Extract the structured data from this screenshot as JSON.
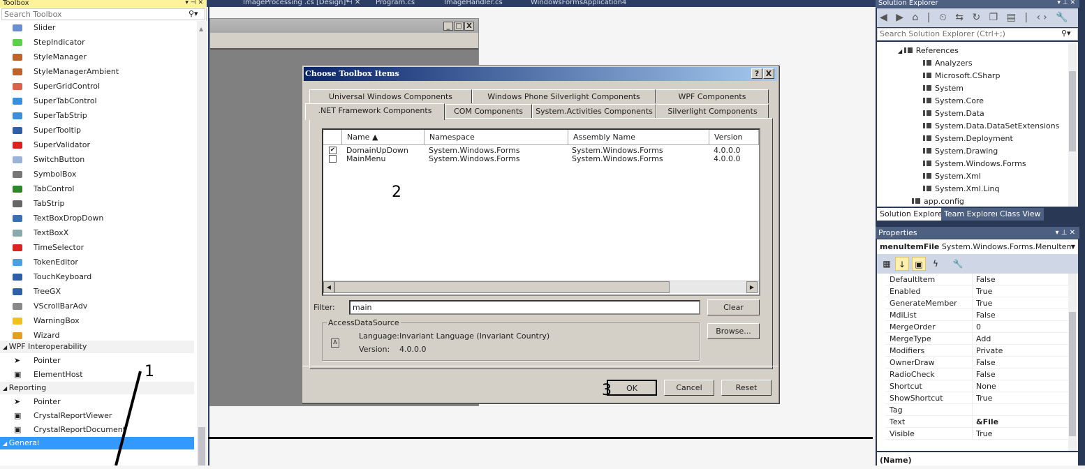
{
  "toolbox": {
    "title": "Toolbox",
    "search_placeholder": "Search Toolbox",
    "items": [
      {
        "label": "Slider",
        "icon": "slider-icon",
        "color": "#6a8fd0"
      },
      {
        "label": "StepIndicator",
        "icon": "step-indicator-icon",
        "color": "#5bd14a"
      },
      {
        "label": "StyleManager",
        "icon": "brush-icon",
        "color": "#c0632b"
      },
      {
        "label": "StyleManagerAmbient",
        "icon": "brush-icon",
        "color": "#c0632b"
      },
      {
        "label": "SuperGridControl",
        "icon": "grid-icon",
        "color": "#d9624a"
      },
      {
        "label": "SuperTabControl",
        "icon": "folder-tab-icon",
        "color": "#3c8fd8"
      },
      {
        "label": "SuperTabStrip",
        "icon": "folder-tab-icon",
        "color": "#3c8fd8"
      },
      {
        "label": "SuperTooltip",
        "icon": "tooltip-icon",
        "color": "#2e5fa8"
      },
      {
        "label": "SuperValidator",
        "icon": "validator-icon",
        "color": "#d22"
      },
      {
        "label": "SwitchButton",
        "icon": "switch-icon",
        "color": "#9bb3d6"
      },
      {
        "label": "SymbolBox",
        "icon": "lightbulb-icon",
        "color": "#777"
      },
      {
        "label": "TabControl",
        "icon": "tab-control-icon",
        "color": "#2a8a2a"
      },
      {
        "label": "TabStrip",
        "icon": "tab-strip-icon",
        "color": "#666"
      },
      {
        "label": "TextBoxDropDown",
        "icon": "textbox-dropdown-icon",
        "color": "#3a6fb0"
      },
      {
        "label": "TextBoxX",
        "icon": "textbox-icon",
        "color": "#8aa"
      },
      {
        "label": "TimeSelector",
        "icon": "time-selector-icon",
        "color": "#d22"
      },
      {
        "label": "TokenEditor",
        "icon": "token-icon",
        "color": "#4aa0e0"
      },
      {
        "label": "TouchKeyboard",
        "icon": "keyboard-icon",
        "color": "#2e5fa8"
      },
      {
        "label": "TreeGX",
        "icon": "tree-icon",
        "color": "#2e5fa8"
      },
      {
        "label": "VScrollBarAdv",
        "icon": "scrollbar-icon",
        "color": "#888"
      },
      {
        "label": "WarningBox",
        "icon": "warning-icon",
        "color": "#f0c020"
      },
      {
        "label": "Wizard",
        "icon": "wand-icon",
        "color": "#e0a020"
      }
    ],
    "categories": [
      {
        "label": "WPF Interoperability",
        "items": [
          {
            "label": "Pointer",
            "icon": "pointer-icon"
          },
          {
            "label": "ElementHost",
            "icon": "element-host-icon"
          }
        ]
      },
      {
        "label": "Reporting",
        "items": [
          {
            "label": "Pointer",
            "icon": "pointer-icon"
          },
          {
            "label": "CrystalReportViewer",
            "icon": "report-viewer-icon"
          },
          {
            "label": "CrystalReportDocument",
            "icon": "report-document-icon"
          }
        ]
      },
      {
        "label": "General",
        "selected": true,
        "items": []
      }
    ]
  },
  "doc_tabs": [
    "ImageProcessing .cs [Design]*",
    "Program.cs",
    "ImageHandler.cs",
    "WindowsFormsApplication4"
  ],
  "dialog": {
    "title": "Choose Toolbox Items",
    "help": "?",
    "close": "X",
    "tabs_back": [
      "Universal Windows Components",
      "Windows Phone Silverlight Components",
      "WPF Components"
    ],
    "tabs_front": [
      ".NET Framework Components",
      "COM Components",
      "System.Activities Components",
      "Silverlight Components"
    ],
    "active_tab": ".NET Framework Components",
    "columns": [
      "Name ▲",
      "Namespace",
      "Assembly Name",
      "Version"
    ],
    "rows": [
      {
        "checked": true,
        "name": "DomainUpDown",
        "namespace": "System.Windows.Forms",
        "assembly": "System.Windows.Forms",
        "version": "4.0.0.0"
      },
      {
        "checked": false,
        "name": "MainMenu",
        "namespace": "System.Windows.Forms",
        "assembly": "System.Windows.Forms",
        "version": "4.0.0.0"
      }
    ],
    "filter_label": "Filter:",
    "filter_value": "main",
    "clear": "Clear",
    "browse": "Browse...",
    "group_title": "AccessDataSource",
    "language_label": "Language:",
    "language_value": "Invariant Language (Invariant Country)",
    "version_label": "Version:",
    "version_value": "4.0.0.0",
    "ok": "OK",
    "cancel": "Cancel",
    "reset": "Reset"
  },
  "annotations": [
    "1",
    "2",
    "3"
  ],
  "solution_explorer": {
    "title": "Solution Explorer",
    "search_placeholder": "Search Solution Explorer (Ctrl+;)",
    "toolbar": "◀ ▶ ⌂ | ⏲ ⇆ ↻ ❐ ▤ | ‹› 🔧 ━",
    "tree": [
      "References",
      "Analyzers",
      "Microsoft.CSharp",
      "System",
      "System.Core",
      "System.Data",
      "System.Data.DataSetExtensions",
      "System.Deployment",
      "System.Drawing",
      "System.Windows.Forms",
      "System.Xml",
      "System.Xml.Linq",
      "app.config"
    ],
    "tabs": [
      "Solution Explorer",
      "Team Explorer",
      "Class View"
    ]
  },
  "properties": {
    "title": "Properties",
    "object_name": "menuItemFile",
    "object_type": "System.Windows.Forms.MenuItem",
    "rows": [
      {
        "name": "DefaultItem",
        "value": "False"
      },
      {
        "name": "Enabled",
        "value": "True"
      },
      {
        "name": "GenerateMember",
        "value": "True"
      },
      {
        "name": "MdiList",
        "value": "False"
      },
      {
        "name": "MergeOrder",
        "value": "0"
      },
      {
        "name": "MergeType",
        "value": "Add"
      },
      {
        "name": "Modifiers",
        "value": "Private"
      },
      {
        "name": "OwnerDraw",
        "value": "False"
      },
      {
        "name": "RadioCheck",
        "value": "False"
      },
      {
        "name": "Shortcut",
        "value": "None"
      },
      {
        "name": "ShowShortcut",
        "value": "True"
      },
      {
        "name": "Tag",
        "value": ""
      },
      {
        "name": "Text",
        "value": "&File",
        "bold": true
      },
      {
        "name": "Visible",
        "value": "True"
      }
    ],
    "description": "(Name)"
  }
}
